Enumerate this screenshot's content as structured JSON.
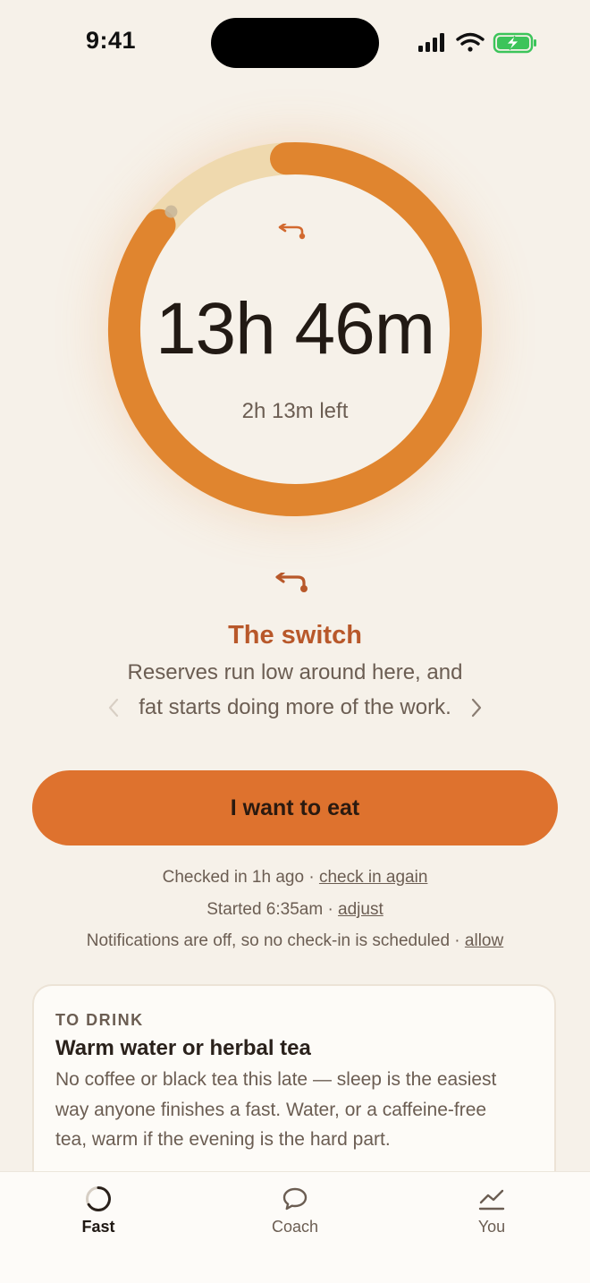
{
  "status_bar": {
    "time": "9:41"
  },
  "timer": {
    "elapsed": "13h 46m",
    "remaining": "2h 13m left",
    "progress": 0.8625
  },
  "phase": {
    "title": "The switch",
    "description": "Reserves run low around here, and fat starts doing more of the work."
  },
  "primary_action": {
    "label": "I want to eat"
  },
  "info": {
    "checkin_text": "Checked in 1h ago · ",
    "checkin_link": "check in again",
    "started_text": "Started 6:35am · ",
    "started_link": "adjust",
    "notifications_text": "Notifications are off, so no check-in is scheduled · ",
    "notifications_link": "allow"
  },
  "card": {
    "label": "TO DRINK",
    "title": "Warm water or herbal tea",
    "body": "No coffee or black tea this late — sleep is the easiest way anyone finishes a fast. Water, or a caffeine-free tea, warm if the evening is the hard part."
  },
  "tabs": [
    {
      "label": "Fast",
      "icon": "progress-ring-icon",
      "active": true
    },
    {
      "label": "Coach",
      "icon": "chat-bubble-icon",
      "active": false
    },
    {
      "label": "You",
      "icon": "trend-chart-icon",
      "active": false
    }
  ],
  "colors": {
    "background": "#f6f1e9",
    "accent": "#de722e",
    "ring": "#e0852f",
    "ring_track": "#efd9ae",
    "phase_title": "#b8582a"
  }
}
